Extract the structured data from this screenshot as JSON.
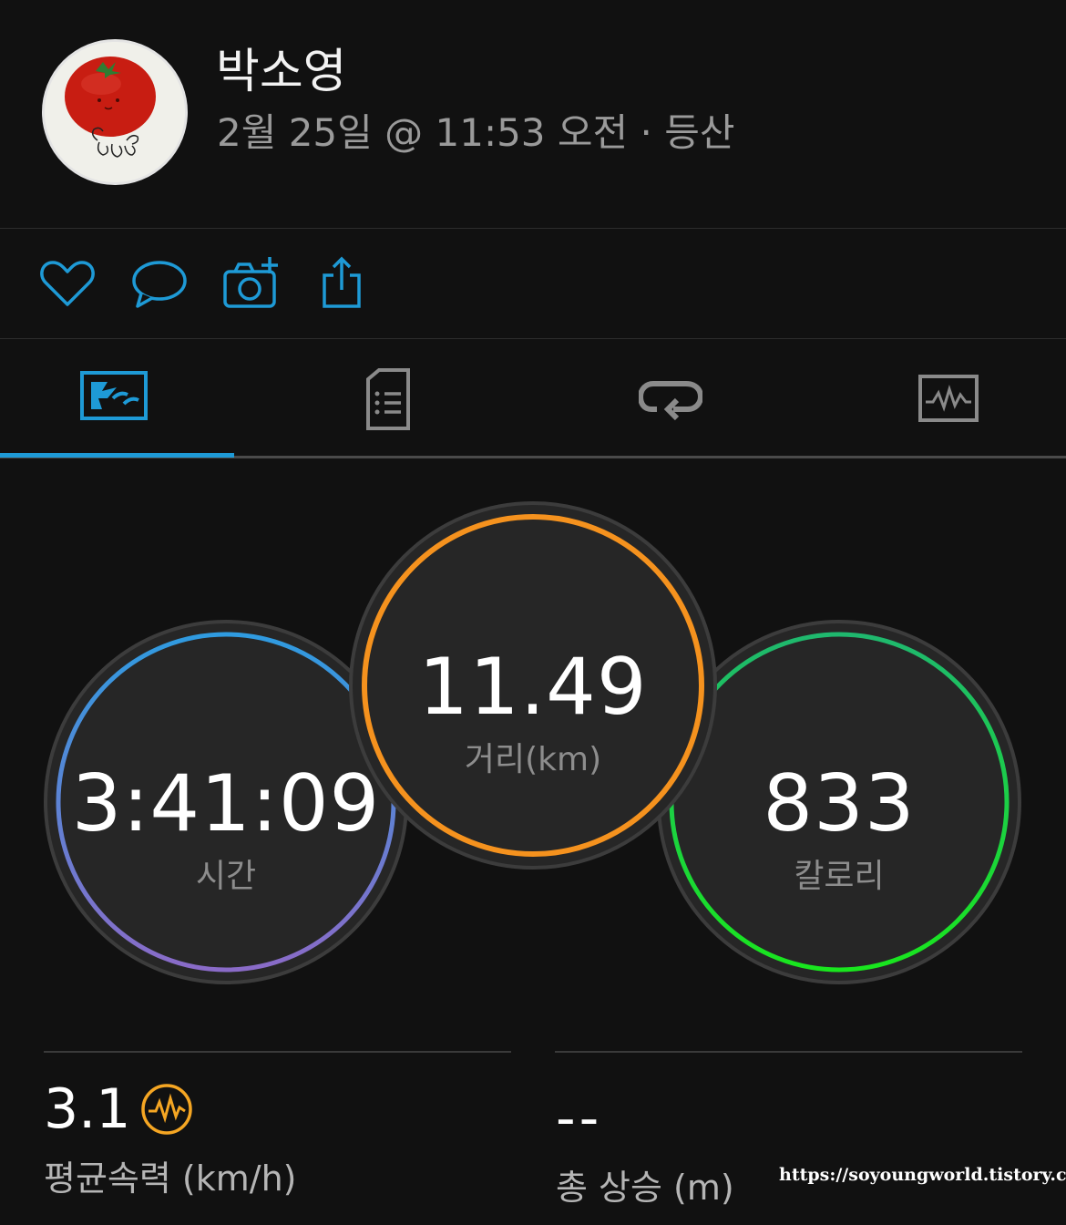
{
  "header": {
    "user_name": "박소영",
    "activity_meta": "2월 25일 @ 11:53 오전 · 등산"
  },
  "actions": [
    {
      "icon": "heart-icon"
    },
    {
      "icon": "comment-icon"
    },
    {
      "icon": "add-photo-icon"
    },
    {
      "icon": "share-icon"
    }
  ],
  "tabs": [
    {
      "icon": "map-icon",
      "active": true
    },
    {
      "icon": "details-document-icon",
      "active": false
    },
    {
      "icon": "laps-repeat-icon",
      "active": false
    },
    {
      "icon": "chart-graph-icon",
      "active": false
    }
  ],
  "rings": {
    "time": {
      "value": "3:41:09",
      "label": "시간"
    },
    "distance": {
      "value": "11.49",
      "label": "거리(km)"
    },
    "calories": {
      "value": "833",
      "label": "칼로리"
    }
  },
  "stats": {
    "avg_speed": {
      "value": "3.1",
      "label": "평균속력 (km/h)"
    },
    "total_ascent": {
      "value": "--",
      "label": "총 상승 (m)"
    }
  },
  "watermark": "https://soyoungworld.tistory.com",
  "colors": {
    "background": "#111111",
    "accent_blue": "#1e9ad6",
    "time_ring_start": "#2f9be0",
    "time_ring_end": "#8a6bc8",
    "distance_ring": "#f5921e",
    "calories_ring_start": "#1fb86e",
    "calories_ring_end": "#19e61e",
    "speed_icon": "#f5a623"
  }
}
